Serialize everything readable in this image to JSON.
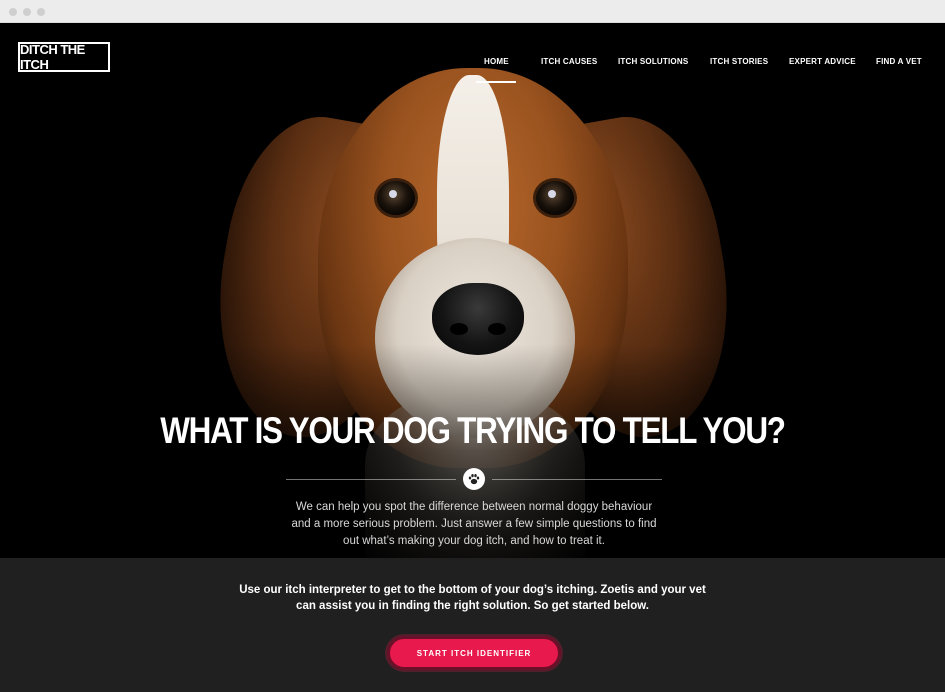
{
  "brand": {
    "logo_text": "DITCH THE ITCH"
  },
  "nav": {
    "items": [
      {
        "label": "HOME",
        "active": true
      },
      {
        "label": "ITCH CAUSES"
      },
      {
        "label": "ITCH SOLUTIONS"
      },
      {
        "label": "ITCH STORIES"
      },
      {
        "label": "EXPERT ADVICE"
      },
      {
        "label": "FIND A VET"
      }
    ]
  },
  "hero": {
    "headline": "WHAT IS YOUR DOG TRYING TO TELL YOU?",
    "icon": "paw-icon",
    "subtext": "We can help you spot the difference between normal doggy behaviour and a more serious problem. Just answer a few simple questions to find out what’s making your dog itch, and how to treat it."
  },
  "intro": {
    "text": "Use our itch interpreter to get to the bottom of your dog’s itching. Zoetis and your vet can assist you in finding the right solution. So get started below.",
    "cta_label": "START ITCH IDENTIFIER"
  },
  "colors": {
    "accent": "#e8194c",
    "hero_bg": "#000000",
    "lower_bg": "#202020"
  }
}
